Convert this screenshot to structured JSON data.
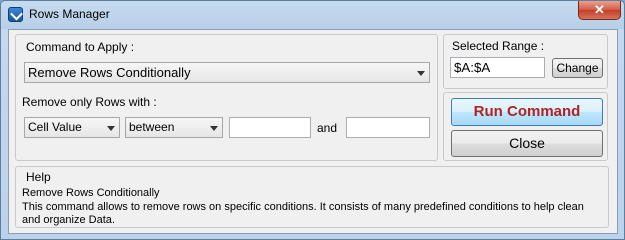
{
  "window": {
    "title": "Rows Manager",
    "close_glyph": "✕"
  },
  "command": {
    "label": "Command to Apply :",
    "selected": "Remove Rows Conditionally"
  },
  "range": {
    "label": "Selected Range :",
    "value": "$A:$A",
    "change_label": "Change"
  },
  "filter": {
    "label": "Remove only Rows with :",
    "field": "Cell Value",
    "operator": "between",
    "value1": "",
    "value2": "",
    "and_label": "and"
  },
  "actions": {
    "run_label": "Run Command",
    "close_label": "Close"
  },
  "help": {
    "label": "Help",
    "title": "Remove Rows Conditionally",
    "body": "This command allows to remove rows on specific conditions. It consists of many predefined conditions to help clean and organize Data."
  }
}
